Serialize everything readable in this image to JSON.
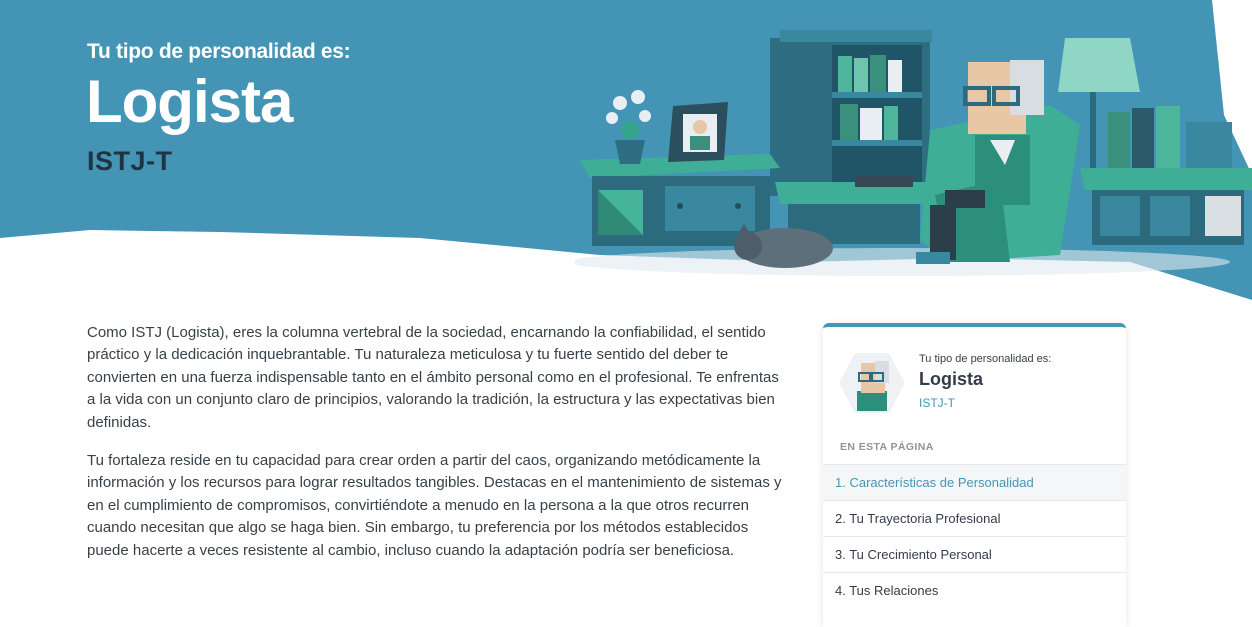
{
  "hero": {
    "eyebrow": "Tu tipo de personalidad es:",
    "title": "Logista",
    "code": "ISTJ-T"
  },
  "article": {
    "paragraphs": [
      "Como ISTJ (Logista), eres la columna vertebral de la sociedad, encarnando la confiabilidad, el sentido práctico y la dedicación inquebrantable. Tu naturaleza meticulosa y tu fuerte sentido del deber te convierten en una fuerza indispensable tanto en el ámbito personal como en el profesional. Te enfrentas a la vida con un conjunto claro de principios, valorando la tradición, la estructura y las expectativas bien definidas.",
      "Tu fortaleza reside en tu capacidad para crear orden a partir del caos, organizando metódicamente la información y los recursos para lograr resultados tangibles. Destacas en el mantenimiento de sistemas y en el cumplimiento de compromisos, convirtiéndote a menudo en la persona a la que otros recurren cuando necesitan que algo se haga bien. Sin embargo, tu preferencia por los métodos establecidos puede hacerte a veces resistente al cambio, incluso cuando la adaptación podría ser beneficiosa."
    ]
  },
  "sidebar": {
    "eyebrow": "Tu tipo de personalidad es:",
    "name": "Logista",
    "code": "ISTJ-T",
    "toc_heading": "EN ESTA PÁGINA",
    "toc": [
      "1. Características de Personalidad",
      "2. Tu Trayectoria Profesional",
      "3. Tu Crecimiento Personal",
      "4. Tus Relaciones"
    ],
    "active_index": 0
  },
  "colors": {
    "hero_background": "#4495b5",
    "accent": "#4298b4",
    "heading_dark": "#1f3342",
    "body_text": "#384148"
  },
  "icons": [
    "logista-illustration",
    "logista-avatar"
  ]
}
